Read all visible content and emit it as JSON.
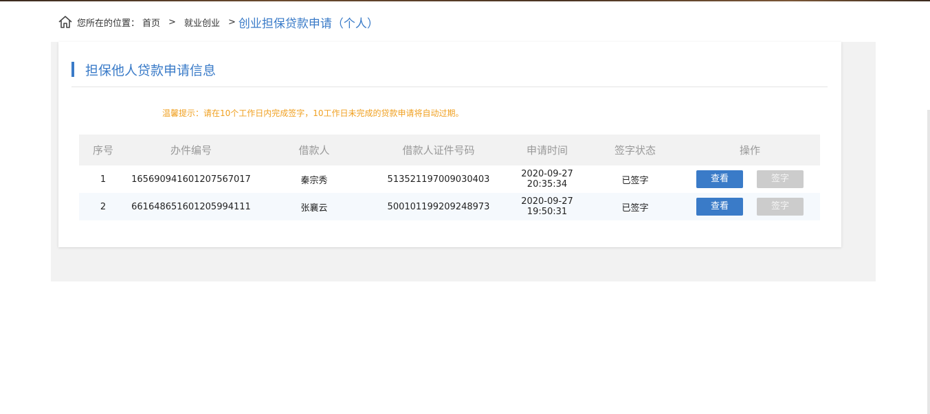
{
  "breadcrumb": {
    "prefix": "您所在的位置：",
    "home": "首页",
    "sep1": ">",
    "level2": "就业创业",
    "sep2": ">",
    "current": "创业担保贷款申请（个人）"
  },
  "section": {
    "title": "担保他人贷款申请信息",
    "tip": "温馨提示：请在10个工作日内完成签字，10工作日未完成的贷款申请将自动过期。"
  },
  "table": {
    "headers": [
      "序号",
      "办件编号",
      "借款人",
      "借款人证件号码",
      "申请时间",
      "签字状态",
      "操作"
    ],
    "rows": [
      {
        "index": "1",
        "case_no": "165690941601207567017",
        "borrower": "秦宗秀",
        "id_no": "513521197009030403",
        "time": "2020-09-27 20:35:34",
        "status": "已签字",
        "view": "查看",
        "sign": "签字"
      },
      {
        "index": "2",
        "case_no": "661648651601205994111",
        "borrower": "张襄云",
        "id_no": "500101199209248973",
        "time": "2020-09-27 19:50:31",
        "status": "已签字",
        "view": "查看",
        "sign": "签字"
      }
    ]
  },
  "colors": {
    "accent": "#3a7bc8",
    "tip": "#f0a020",
    "disabled": "#cccccc"
  }
}
